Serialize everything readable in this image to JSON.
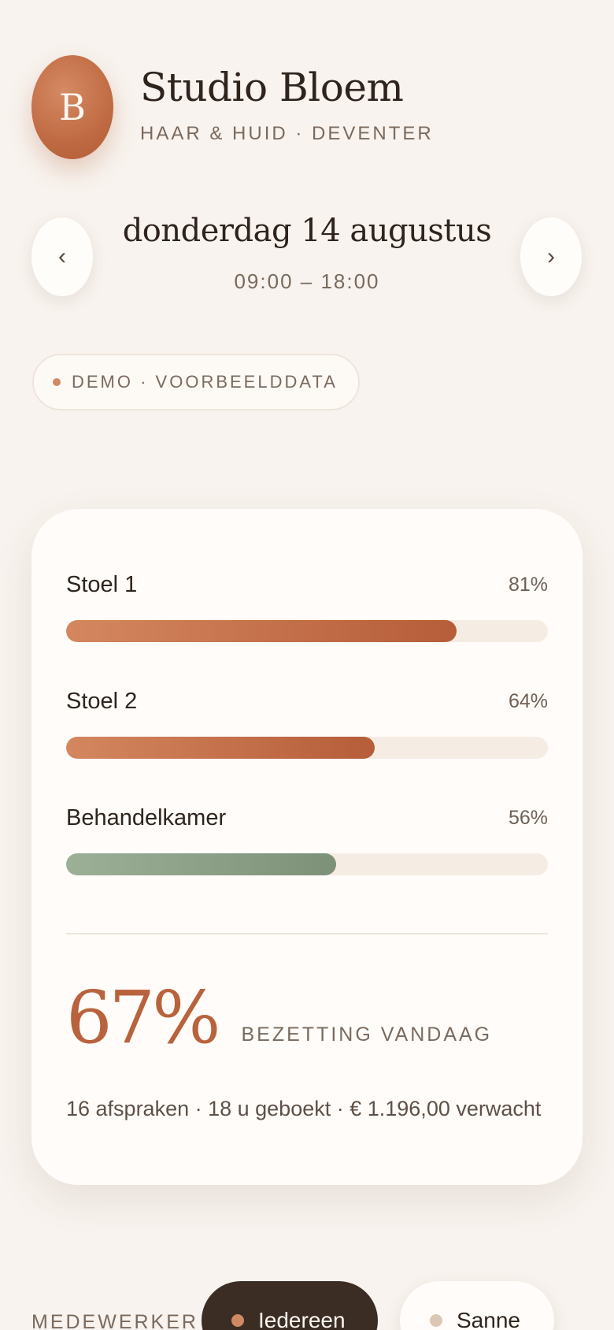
{
  "header": {
    "logo_letter": "B",
    "business_name": "Studio Bloem",
    "tagline": "HAAR & HUID · DEVENTER"
  },
  "date_nav": {
    "prev_icon": "‹",
    "next_icon": "›",
    "date": "donderdag 14 augustus",
    "hours": "09:00 – 18:00"
  },
  "demo_badge": {
    "label": "DEMO · VOORBEELDDATA"
  },
  "occupancy": {
    "resources": [
      {
        "name": "Stoel 1",
        "percent_label": "81%",
        "value": 81,
        "color": "terra"
      },
      {
        "name": "Stoel 2",
        "percent_label": "64%",
        "value": 64,
        "color": "terra"
      },
      {
        "name": "Behandelkamer",
        "percent_label": "56%",
        "value": 56,
        "color": "sage"
      }
    ],
    "total_value": "67%",
    "total_label": "BEZETTING VANDAAG",
    "summary": "16 afspraken · 18 u geboekt · € 1.196,00 verwacht"
  },
  "staff_filter": {
    "label": "MEDEWERKER",
    "chips": [
      {
        "label": "Iedereen",
        "selected": true
      },
      {
        "label": "Sanne",
        "selected": false
      }
    ]
  },
  "colors": {
    "accent": "#c06a43",
    "sage": "#7c9178",
    "background": "#f8f3ee"
  }
}
